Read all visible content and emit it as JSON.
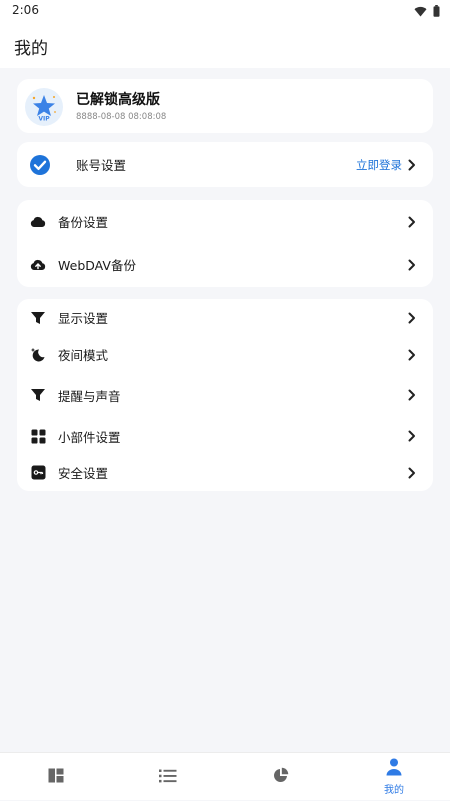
{
  "status_bar": {
    "time": "2:06",
    "icons": [
      "wifi-icon",
      "battery-icon"
    ]
  },
  "header": {
    "title": "我的"
  },
  "vip": {
    "title": "已解锁高级版",
    "date": "8888-08-08 08:08:08",
    "icon": "vip-star-icon"
  },
  "account": {
    "label": "账号设置",
    "action_label": "立即登录",
    "icon": "check-circle-icon"
  },
  "backup_group": {
    "items": [
      {
        "label": "备份设置",
        "icon": "cloud-icon"
      },
      {
        "label": "WebDAV备份",
        "icon": "cloud-upload-icon"
      }
    ]
  },
  "settings_group": {
    "items": [
      {
        "label": "显示设置",
        "icon": "funnel-icon"
      },
      {
        "label": "夜间模式",
        "icon": "moon-icon"
      },
      {
        "label": "提醒与声音",
        "icon": "funnel-icon"
      },
      {
        "label": "小部件设置",
        "icon": "widgets-grid-icon"
      },
      {
        "label": "安全设置",
        "icon": "key-icon"
      }
    ]
  },
  "bottom_nav": {
    "items": [
      {
        "icon": "dashboard-icon",
        "label": ""
      },
      {
        "icon": "list-icon",
        "label": ""
      },
      {
        "icon": "pie-chart-icon",
        "label": ""
      },
      {
        "icon": "person-icon",
        "label": "我的",
        "active": true
      }
    ]
  },
  "colors": {
    "accent": "#1e73d9",
    "nav_active": "#2f7be5",
    "background": "#f5f6f9",
    "card": "#ffffff"
  }
}
